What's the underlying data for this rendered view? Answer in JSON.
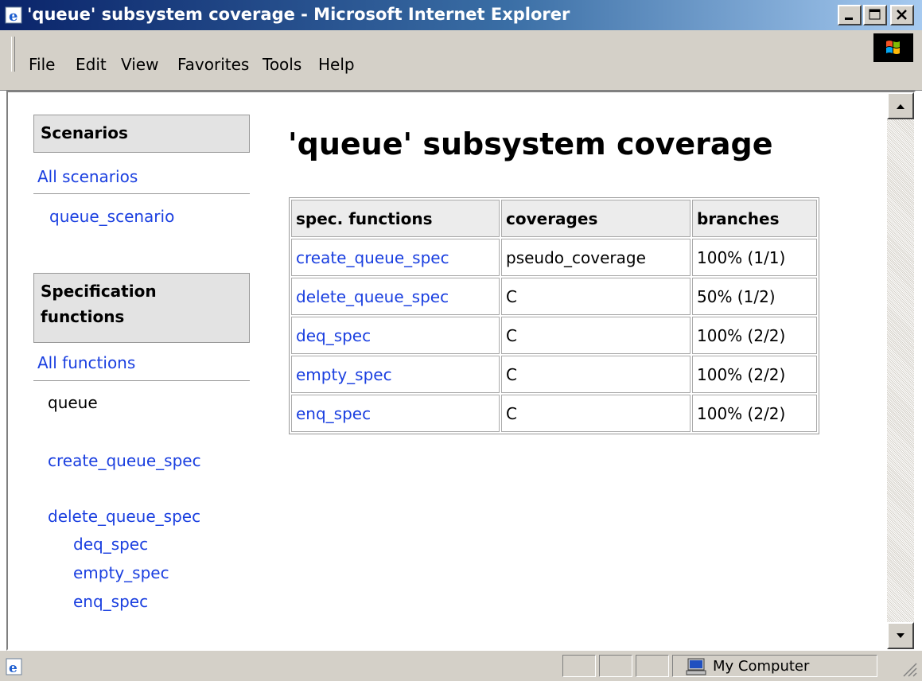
{
  "window": {
    "title": "'queue' subsystem coverage - Microsoft Internet Explorer"
  },
  "menu": {
    "items": [
      "File",
      "Edit",
      "View",
      "Favorites",
      "Tools",
      "Help"
    ]
  },
  "sidebar": {
    "scenarios_header": "Scenarios",
    "all_scenarios": "All scenarios",
    "scenario_items": [
      "queue_scenario"
    ],
    "functions_header_line1": "Specification",
    "functions_header_line2": "functions",
    "all_functions": "All functions",
    "group_label": "queue",
    "function_items": [
      "create_queue_spec",
      "delete_queue_spec",
      "deq_spec",
      "empty_spec",
      "enq_spec"
    ]
  },
  "main": {
    "title": "'queue' subsystem coverage",
    "table": {
      "headers": [
        "spec. functions",
        "coverages",
        "branches"
      ],
      "rows": [
        [
          "create_queue_spec",
          "pseudo_coverage",
          "100% (1/1)"
        ],
        [
          "delete_queue_spec",
          "C",
          "50% (1/2)"
        ],
        [
          "deq_spec",
          "C",
          "100% (2/2)"
        ],
        [
          "empty_spec",
          "C",
          "100% (2/2)"
        ],
        [
          "enq_spec",
          "C",
          "100% (2/2)"
        ]
      ]
    }
  },
  "statusbar": {
    "zone": "My Computer"
  },
  "icons": {
    "title": "ie-icon",
    "status": "ie-page-icon",
    "zone": "computer-icon",
    "brand": "windows-logo-icon"
  },
  "colors": {
    "titlebar_start": "#0a246a",
    "titlebar_end": "#a6caf0",
    "link": "#1a3fe0",
    "chrome": "#d4d0c8"
  }
}
